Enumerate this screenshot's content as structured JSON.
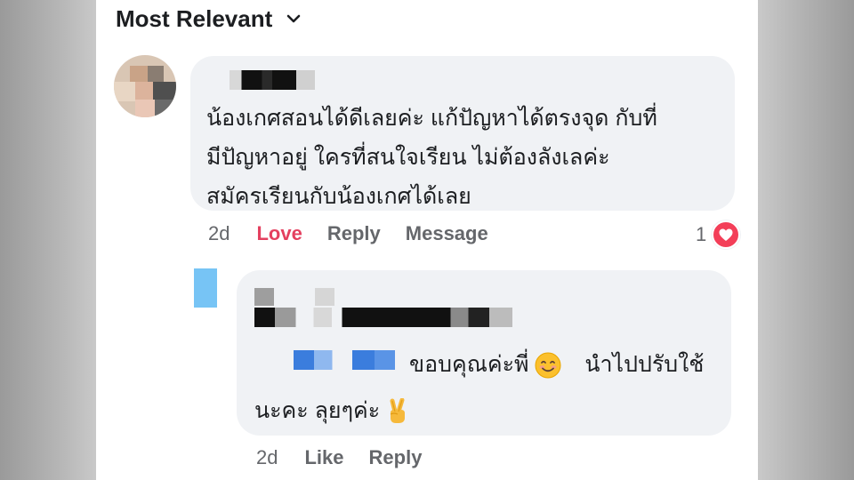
{
  "sort": {
    "label": "Most Relevant"
  },
  "comment": {
    "text_lines": [
      "น้องเกศสอนได้ดีเลยค่ะ  แก้ปัญหาได้ตรงจุด  กับที่",
      "มีปัญหาอยู่  ใครที่สนใจเรียน ไม่ต้องลังเลค่ะ",
      "สมัครเรียนกับน้องเกศได้เลย"
    ],
    "time": "2d",
    "actions": {
      "love": "Love",
      "reply": "Reply",
      "message": "Message"
    },
    "reaction_count": "1"
  },
  "reply": {
    "text_part1": "ขอบคุณค่ะพี่",
    "text_part2": "นำไปปรับใช้",
    "text_line2": "นะคะ ลุยๆค่ะ",
    "time": "2d",
    "actions": {
      "like": "Like",
      "reply": "Reply"
    }
  },
  "colors": {
    "love": "#e4405f",
    "heart": "#f33e58",
    "bubble": "#f0f2f5",
    "meta": "#65676b",
    "mention": "#3b7ddd"
  },
  "icons": {
    "sort": "chevron-down-icon",
    "reaction": "heart-icon",
    "emoji1": "smiling-face-emoji",
    "emoji2": "victory-hand-emoji"
  }
}
